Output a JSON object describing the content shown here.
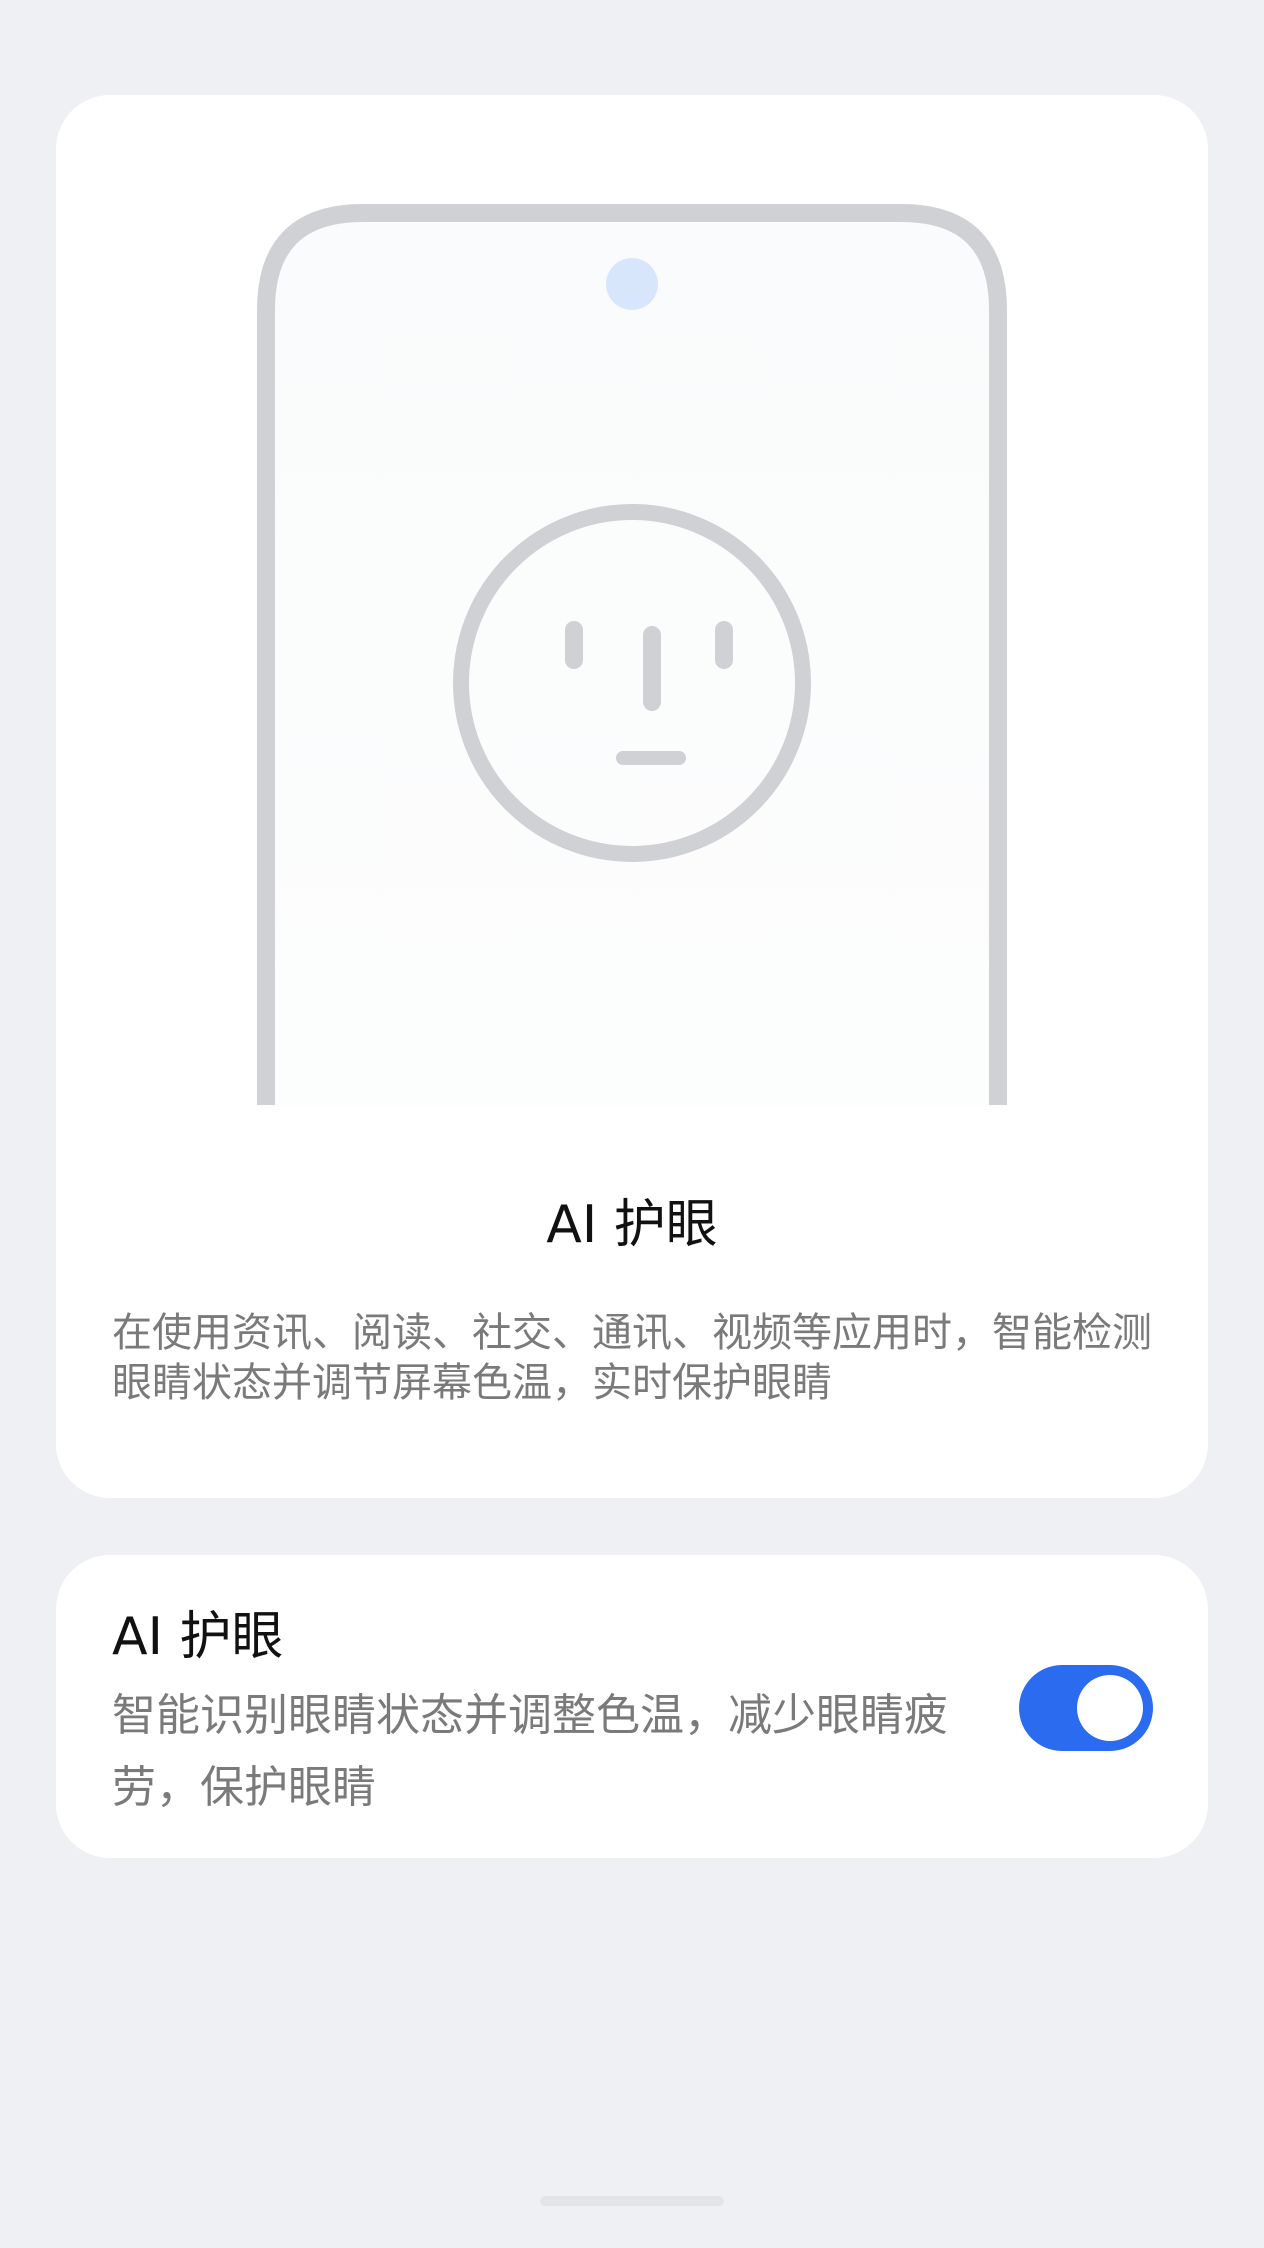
{
  "hero": {
    "title": "AI 护眼",
    "description": "在使用资讯、阅读、社交、通讯、视频等应用时，智能检测眼睛状态并调节屏幕色温，实时保护眼睛",
    "illustration_icon": "phone-with-face-icon"
  },
  "setting": {
    "title": "AI 护眼",
    "description": "智能识别眼睛状态并调整色温，减少眼睛疲劳，保护眼睛",
    "toggle_on": true,
    "toggle_color": "#2a6bf0"
  },
  "colors": {
    "background": "#eff0f3",
    "card": "#ffffff",
    "outline": "#d0d1d5",
    "camera": "#d8e6fb",
    "title_text": "#111111",
    "body_text": "#7a7a7a"
  }
}
